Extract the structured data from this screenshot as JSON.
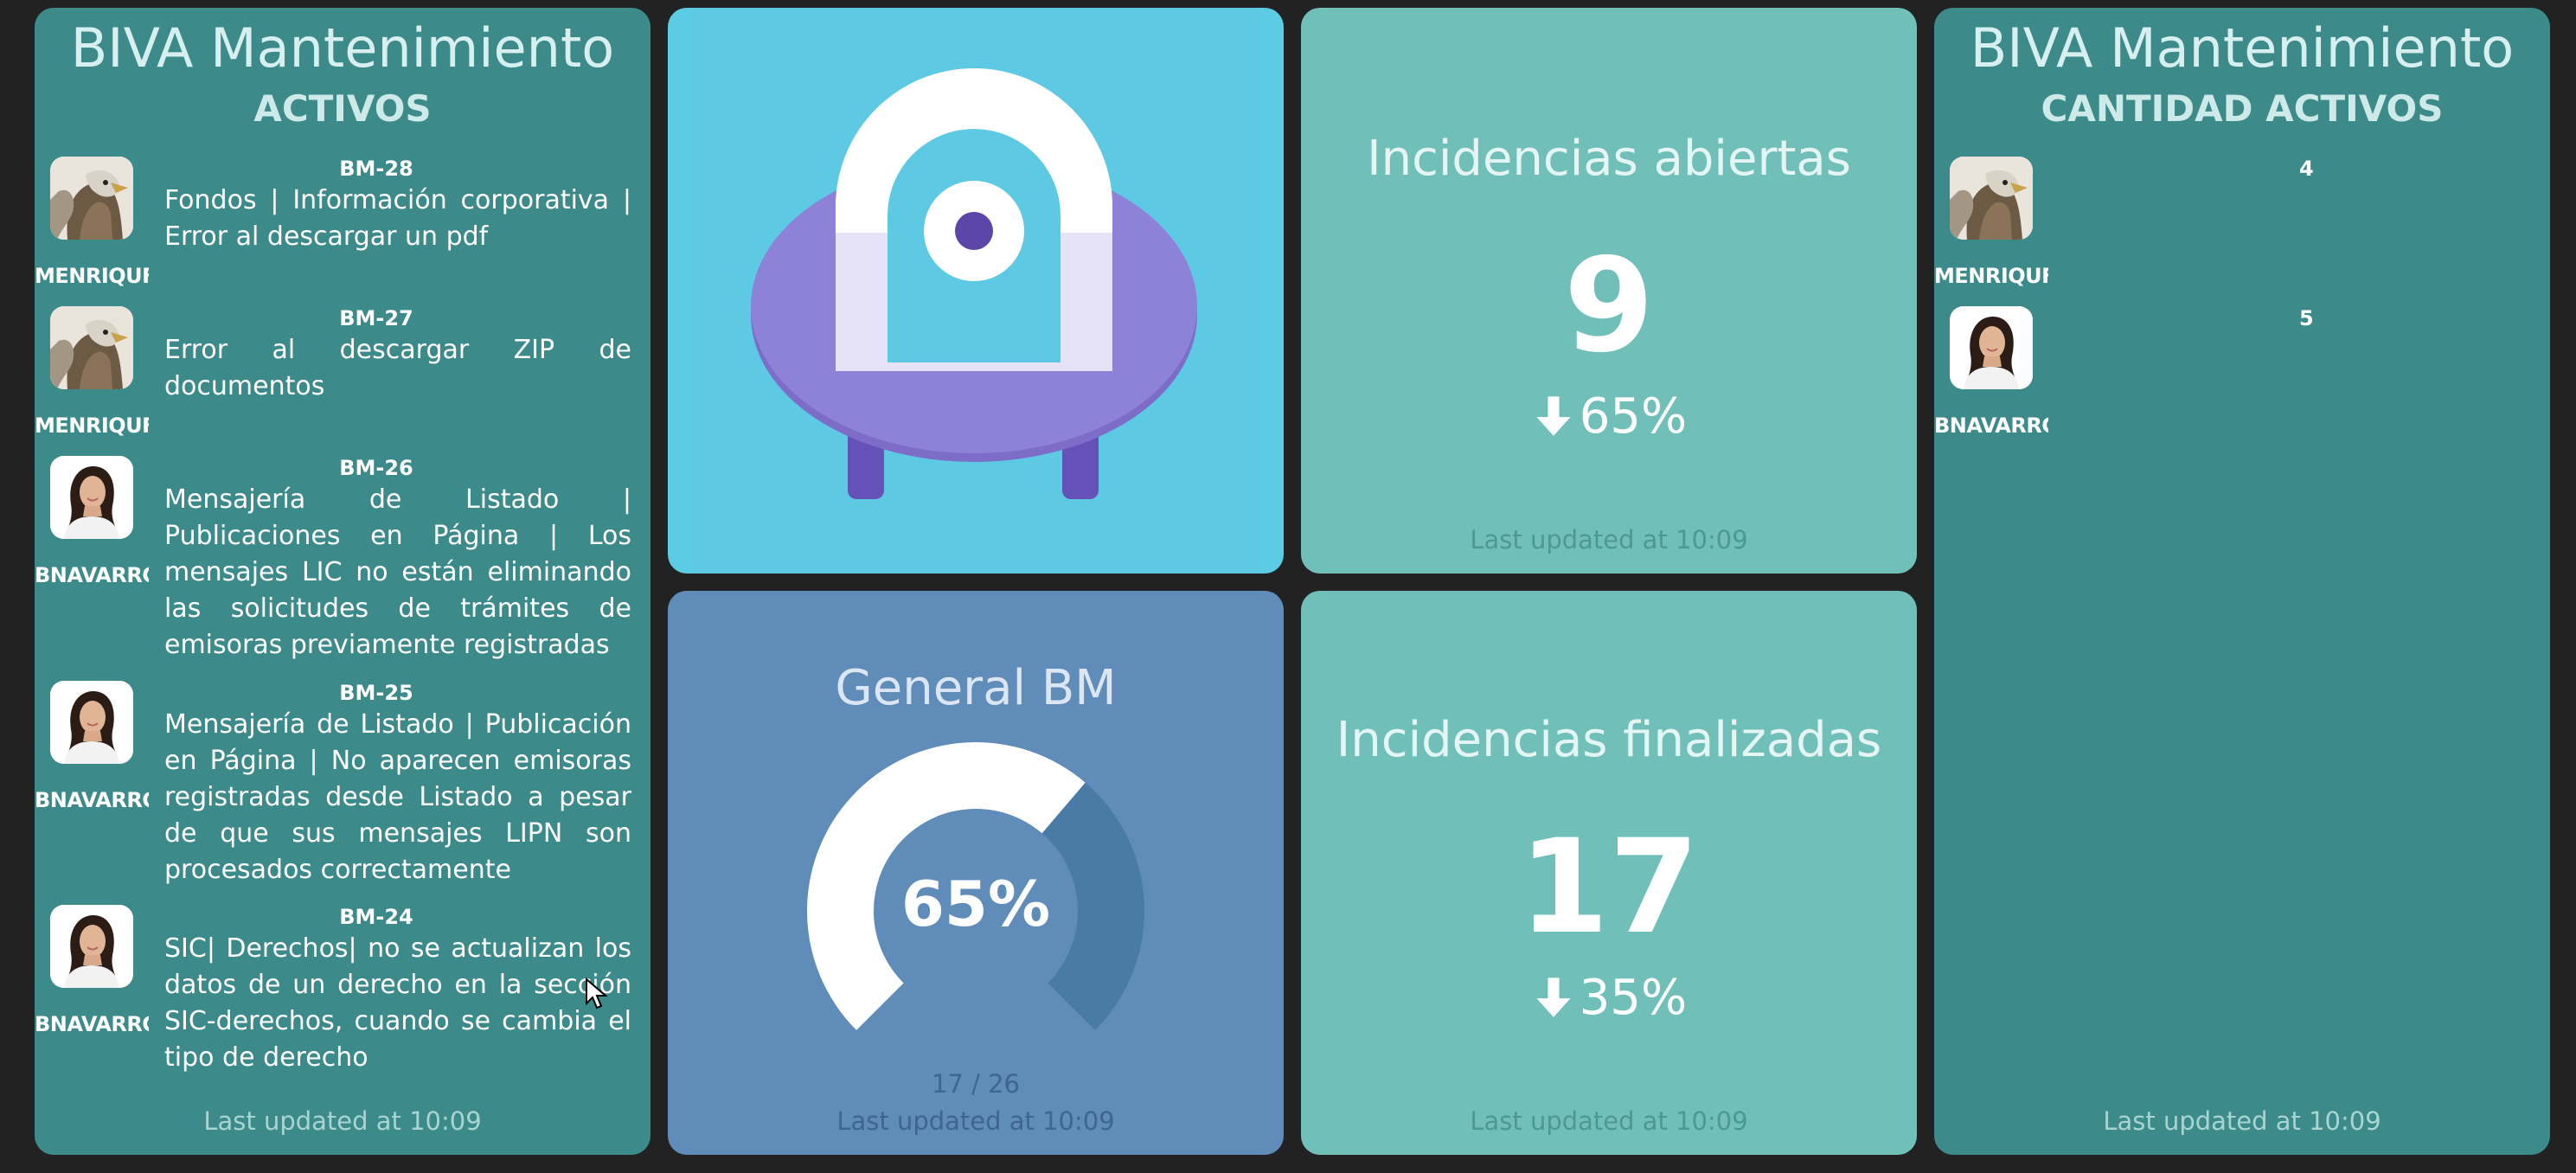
{
  "activos": {
    "title": "BIVA Mantenimiento",
    "subtitle": "ACTIVOS",
    "items": [
      {
        "code": "BM-28",
        "user": "MENRIQUF",
        "avatar": "eagle-avatar",
        "desc": "Fondos | Información corporativa | Error al descargar un pdf"
      },
      {
        "code": "BM-27",
        "user": "MENRIQUF",
        "avatar": "eagle-avatar",
        "desc": "Error al descargar ZIP de documentos"
      },
      {
        "code": "BM-26",
        "user": "BNAVARRC",
        "avatar": "woman-avatar",
        "desc": "Mensajería de Listado | Publicaciones en Página | Los mensajes LIC no están eliminando las solicitudes de trámites de emisoras previamente registradas"
      },
      {
        "code": "BM-25",
        "user": "BNAVARRC",
        "avatar": "woman-avatar",
        "desc": "Mensajería de Listado | Publicación en Página | No aparecen emisoras registradas desde Listado a pesar de que sus mensajes LIPN son procesados correctamente"
      },
      {
        "code": "BM-24",
        "user": "BNAVARRC",
        "avatar": "woman-avatar",
        "desc": "SIC| Derechos| no se actualizan los datos de un derecho en la sección SIC-derechos, cuando se cambia el tipo de derecho"
      }
    ],
    "updated": "Last updated at 10:09"
  },
  "logo": {
    "icon": "robot-logo-icon",
    "colors": {
      "bg": "#5ccbe4",
      "body": "#8e82d8",
      "head": "#ffffff",
      "eye": "#5b46a8"
    }
  },
  "abiertas": {
    "title": "Incidencias abiertas",
    "value": "9",
    "change": "65%",
    "change_icon": "arrow-down-icon",
    "updated": "Last updated at 10:09"
  },
  "finalizadas": {
    "title": "Incidencias finalizadas",
    "value": "17",
    "change": "35%",
    "change_icon": "arrow-down-icon",
    "updated": "Last updated at 10:09"
  },
  "general": {
    "title": "General BM",
    "percent": "65%",
    "fraction": 0.65,
    "count": "17 / 26",
    "updated": "Last updated at 10:09"
  },
  "cantidad": {
    "title": "BIVA Mantenimiento",
    "subtitle": "CANTIDAD ACTIVOS",
    "items": [
      {
        "user": "MENRIQUF",
        "count": "4",
        "avatar": "eagle-avatar"
      },
      {
        "user": "BNAVARRC",
        "count": "5",
        "avatar": "woman-avatar"
      }
    ],
    "updated": "Last updated at 10:09"
  },
  "colors": {
    "background": "#222222",
    "teal_dark": "#3c8a8a",
    "teal_light": "#70c0b9",
    "blue": "#5f8cb9",
    "cyan": "#5ccbe4"
  }
}
